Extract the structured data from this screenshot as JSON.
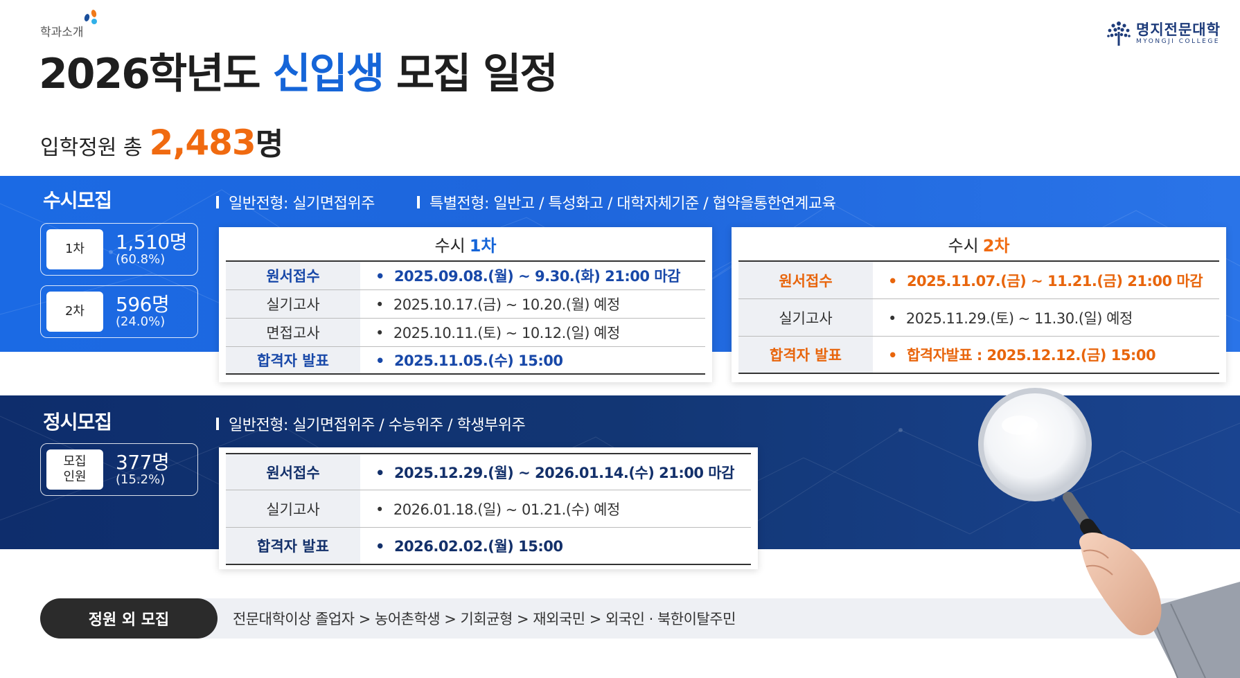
{
  "header": {
    "section_tag": "학과소개",
    "title_prefix": "2026학년도 ",
    "title_accent": "신입생",
    "title_suffix": " 모집 일정",
    "college_name_ko": "명지전문대학",
    "college_name_en": "MYONGJI COLLEGE"
  },
  "total": {
    "label": "입학정원 총",
    "value": "2,483",
    "unit": "명"
  },
  "susi": {
    "title": "수시모집",
    "meta_general": "일반전형: 실기면접위주",
    "meta_special": "특별전형: 일반고 / 특성화고 / 대학자체기준 / 협약을통한연계교육",
    "quotas": [
      {
        "chip": "1차",
        "count": "1,510명",
        "pct": "(60.8%)"
      },
      {
        "chip": "2차",
        "count": "596명",
        "pct": "(24.0%)"
      }
    ],
    "round1": {
      "head_prefix": "수시",
      "head_accent": "1차",
      "rows": [
        {
          "label": "원서접수",
          "value": "2025.09.08.(월) ~ 9.30.(화) 21:00 마감"
        },
        {
          "label": "실기고사",
          "value": "2025.10.17.(금)  ~  10.20.(월) 예정"
        },
        {
          "label": "면접고사",
          "value": "2025.10.11.(토)  ~  10.12.(일) 예정"
        },
        {
          "label": "합격자 발표",
          "value": "2025.11.05.(수) 15:00"
        }
      ]
    },
    "round2": {
      "head_prefix": "수시",
      "head_accent": "2차",
      "rows": [
        {
          "label": "원서접수",
          "value": "2025.11.07.(금) ~ 11.21.(금) 21:00 마감"
        },
        {
          "label": "실기고사",
          "value": "2025.11.29.(토)  ~ 11.30.(일) 예정"
        },
        {
          "label": "합격자 발표",
          "value": "합격자발표 : 2025.12.12.(금) 15:00"
        }
      ]
    }
  },
  "jeongsi": {
    "title": "정시모집",
    "meta_general": "일반전형: 실기면접위주 / 수능위주 / 학생부위주",
    "quota": {
      "chip_line1": "모집",
      "chip_line2": "인원",
      "count": "377명",
      "pct": "(15.2%)"
    },
    "rows": [
      {
        "label": "원서접수",
        "value": "2025.12.29.(월) ~  2026.01.14.(수) 21:00 마감"
      },
      {
        "label": "실기고사",
        "value": "2026.01.18.(일)  ~  01.21.(수) 예정"
      },
      {
        "label": "합격자 발표",
        "value": "2026.02.02.(월) 15:00"
      }
    ]
  },
  "extra": {
    "pill": "정원 외 모집",
    "text": "전문대학이상 졸업자 > 농어촌학생 > 기회균형 > 재외국민 > 외국인 · 북한이탈주민"
  },
  "colors": {
    "accent_blue": "#1565d8",
    "accent_orange": "#f06a10",
    "band_susi": "#1e66dc",
    "band_jeongsi": "#123674"
  }
}
